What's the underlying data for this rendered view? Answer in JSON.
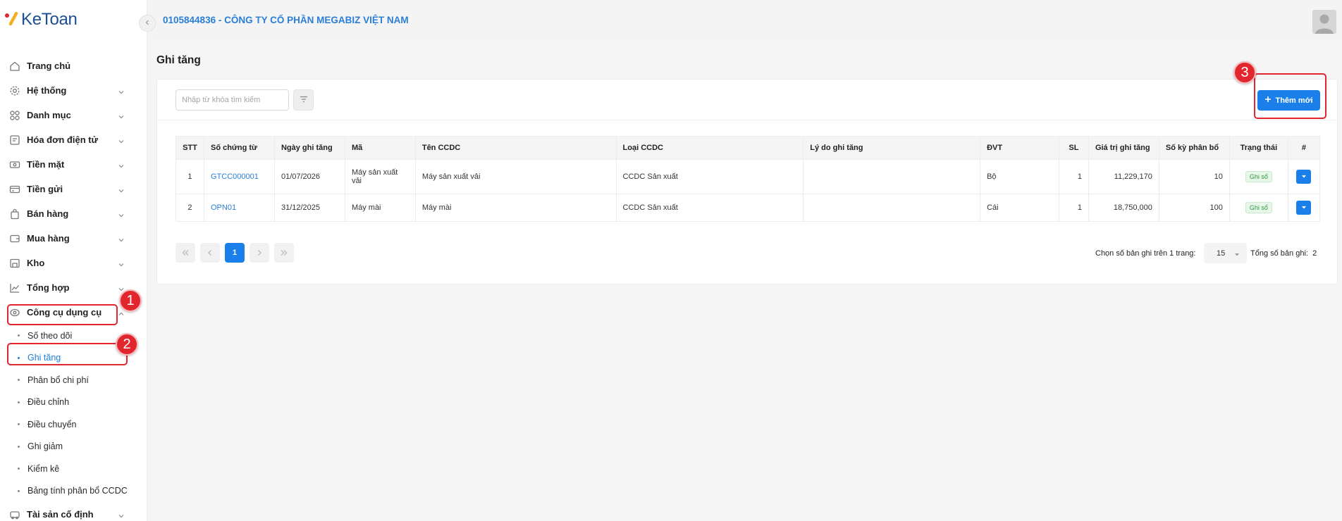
{
  "app": {
    "logo_text": "KeToan"
  },
  "header": {
    "company": "0105844836 - CÔNG TY CỔ PHẦN MEGABIZ VIỆT NAM"
  },
  "sidebar": {
    "items": [
      {
        "label": "Trang chủ",
        "icon": "home-icon"
      },
      {
        "label": "Hệ thống",
        "icon": "gear-icon"
      },
      {
        "label": "Danh mục",
        "icon": "grid-icon"
      },
      {
        "label": "Hóa đơn điện tử",
        "icon": "invoice-icon"
      },
      {
        "label": "Tiền mặt",
        "icon": "cash-icon"
      },
      {
        "label": "Tiền gửi",
        "icon": "bank-icon"
      },
      {
        "label": "Bán hàng",
        "icon": "bag-icon"
      },
      {
        "label": "Mua hàng",
        "icon": "cart-icon"
      },
      {
        "label": "Kho",
        "icon": "warehouse-icon"
      },
      {
        "label": "Tổng hợp",
        "icon": "chart-icon"
      },
      {
        "label": "Công cụ dụng cụ",
        "icon": "tools-icon"
      }
    ],
    "subitems": [
      {
        "label": "Số theo dõi"
      },
      {
        "label": "Ghi tăng"
      },
      {
        "label": "Phân bổ chi phí"
      },
      {
        "label": "Điều chỉnh"
      },
      {
        "label": "Điều chuyển"
      },
      {
        "label": "Ghi giảm"
      },
      {
        "label": "Kiểm kê"
      },
      {
        "label": "Bảng tính phân bổ CCDC"
      }
    ],
    "last_item": {
      "label": "Tài sản cố định",
      "icon": "car-icon"
    }
  },
  "page": {
    "title": "Ghi tăng"
  },
  "search": {
    "placeholder": "Nhập từ khóa tìm kiếm"
  },
  "toolbar": {
    "add_label": "Thêm mới"
  },
  "table": {
    "headers": [
      "STT",
      "Số chứng từ",
      "Ngày ghi tăng",
      "Mã",
      "Tên CCDC",
      "Loại CCDC",
      "Lý do ghi tăng",
      "ĐVT",
      "SL",
      "Giá trị ghi tăng",
      "Số kỳ phân bổ",
      "Trạng thái",
      "#"
    ],
    "rows": [
      {
        "stt": "1",
        "so_ct": "GTCC000001",
        "ngay": "01/07/2026",
        "ma": "Máy sản xuất vải",
        "ten": "Máy sản xuất vải",
        "loai": "CCDC Sản xuất",
        "ly_do": "",
        "dvt": "Bộ",
        "sl": "1",
        "gia_tri": "11,229,170",
        "so_ky": "10",
        "trang_thai": "Ghi sổ"
      },
      {
        "stt": "2",
        "so_ct": "OPN01",
        "ngay": "31/12/2025",
        "ma": "Máy mài",
        "ten": "Máy mài",
        "loai": "CCDC Sản xuất",
        "ly_do": "",
        "dvt": "Cái",
        "sl": "1",
        "gia_tri": "18,750,000",
        "so_ky": "100",
        "trang_thai": "Ghi sổ"
      }
    ]
  },
  "pagination": {
    "current_page": "1",
    "page_size_label": "Chọn số bản ghi trên 1 trang:",
    "page_size": "15",
    "total_label": "Tổng số bản ghi:",
    "total": "2"
  },
  "annotations": [
    "1",
    "2",
    "3"
  ],
  "colors": {
    "accent": "#1a7fe8",
    "highlight": "#e0262f",
    "company_text": "#2a7ed6"
  }
}
